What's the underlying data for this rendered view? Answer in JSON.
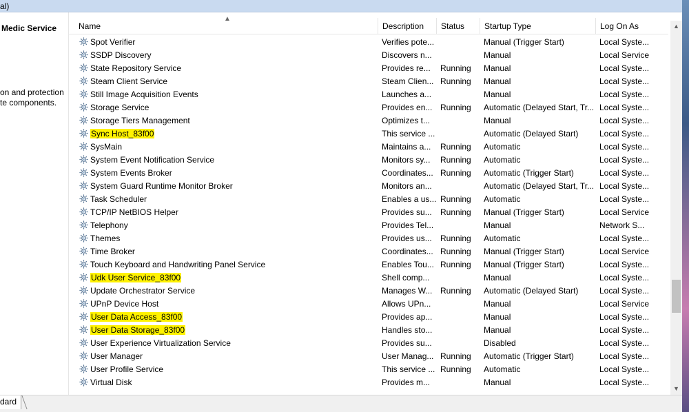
{
  "window": {
    "title_fragment": "al)"
  },
  "left_panel": {
    "service_name": "Medic Service",
    "description_lines": [
      "on and protection",
      "te components."
    ]
  },
  "columns": {
    "name": "Name",
    "description": "Description",
    "status": "Status",
    "startup_type": "Startup Type",
    "log_on_as": "Log On As"
  },
  "services": [
    {
      "name": "Spot Verifier",
      "description": "Verifies pote...",
      "status": "",
      "startup": "Manual (Trigger Start)",
      "logon": "Local Syste...",
      "highlighted": false
    },
    {
      "name": "SSDP Discovery",
      "description": "Discovers n...",
      "status": "",
      "startup": "Manual",
      "logon": "Local Service",
      "highlighted": false
    },
    {
      "name": "State Repository Service",
      "description": "Provides re...",
      "status": "Running",
      "startup": "Manual",
      "logon": "Local Syste...",
      "highlighted": false
    },
    {
      "name": "Steam Client Service",
      "description": "Steam Clien...",
      "status": "Running",
      "startup": "Manual",
      "logon": "Local Syste...",
      "highlighted": false
    },
    {
      "name": "Still Image Acquisition Events",
      "description": "Launches a...",
      "status": "",
      "startup": "Manual",
      "logon": "Local Syste...",
      "highlighted": false
    },
    {
      "name": "Storage Service",
      "description": "Provides en...",
      "status": "Running",
      "startup": "Automatic (Delayed Start, Tr...",
      "logon": "Local Syste...",
      "highlighted": false
    },
    {
      "name": "Storage Tiers Management",
      "description": "Optimizes t...",
      "status": "",
      "startup": "Manual",
      "logon": "Local Syste...",
      "highlighted": false
    },
    {
      "name": "Sync Host_83f00",
      "description": "This service ...",
      "status": "",
      "startup": "Automatic (Delayed Start)",
      "logon": "Local Syste...",
      "highlighted": true
    },
    {
      "name": "SysMain",
      "description": "Maintains a...",
      "status": "Running",
      "startup": "Automatic",
      "logon": "Local Syste...",
      "highlighted": false
    },
    {
      "name": "System Event Notification Service",
      "description": "Monitors sy...",
      "status": "Running",
      "startup": "Automatic",
      "logon": "Local Syste...",
      "highlighted": false
    },
    {
      "name": "System Events Broker",
      "description": "Coordinates...",
      "status": "Running",
      "startup": "Automatic (Trigger Start)",
      "logon": "Local Syste...",
      "highlighted": false
    },
    {
      "name": "System Guard Runtime Monitor Broker",
      "description": "Monitors an...",
      "status": "",
      "startup": "Automatic (Delayed Start, Tr...",
      "logon": "Local Syste...",
      "highlighted": false
    },
    {
      "name": "Task Scheduler",
      "description": "Enables a us...",
      "status": "Running",
      "startup": "Automatic",
      "logon": "Local Syste...",
      "highlighted": false
    },
    {
      "name": "TCP/IP NetBIOS Helper",
      "description": "Provides su...",
      "status": "Running",
      "startup": "Manual (Trigger Start)",
      "logon": "Local Service",
      "highlighted": false
    },
    {
      "name": "Telephony",
      "description": "Provides Tel...",
      "status": "",
      "startup": "Manual",
      "logon": "Network S...",
      "highlighted": false
    },
    {
      "name": "Themes",
      "description": "Provides us...",
      "status": "Running",
      "startup": "Automatic",
      "logon": "Local Syste...",
      "highlighted": false
    },
    {
      "name": "Time Broker",
      "description": "Coordinates...",
      "status": "Running",
      "startup": "Manual (Trigger Start)",
      "logon": "Local Service",
      "highlighted": false
    },
    {
      "name": "Touch Keyboard and Handwriting Panel Service",
      "description": "Enables Tou...",
      "status": "Running",
      "startup": "Manual (Trigger Start)",
      "logon": "Local Syste...",
      "highlighted": false
    },
    {
      "name": "Udk User Service_83f00",
      "description": "Shell comp...",
      "status": "",
      "startup": "Manual",
      "logon": "Local Syste...",
      "highlighted": true
    },
    {
      "name": "Update Orchestrator Service",
      "description": "Manages W...",
      "status": "Running",
      "startup": "Automatic (Delayed Start)",
      "logon": "Local Syste...",
      "highlighted": false
    },
    {
      "name": "UPnP Device Host",
      "description": "Allows UPn...",
      "status": "",
      "startup": "Manual",
      "logon": "Local Service",
      "highlighted": false
    },
    {
      "name": "User Data Access_83f00",
      "description": "Provides ap...",
      "status": "",
      "startup": "Manual",
      "logon": "Local Syste...",
      "highlighted": true
    },
    {
      "name": "User Data Storage_83f00",
      "description": "Handles sto...",
      "status": "",
      "startup": "Manual",
      "logon": "Local Syste...",
      "highlighted": true
    },
    {
      "name": "User Experience Virtualization Service",
      "description": "Provides su...",
      "status": "",
      "startup": "Disabled",
      "logon": "Local Syste...",
      "highlighted": false
    },
    {
      "name": "User Manager",
      "description": "User Manag...",
      "status": "Running",
      "startup": "Automatic (Trigger Start)",
      "logon": "Local Syste...",
      "highlighted": false
    },
    {
      "name": "User Profile Service",
      "description": "This service ...",
      "status": "Running",
      "startup": "Automatic",
      "logon": "Local Syste...",
      "highlighted": false
    },
    {
      "name": "Virtual Disk",
      "description": "Provides m...",
      "status": "",
      "startup": "Manual",
      "logon": "Local Syste...",
      "highlighted": false
    }
  ],
  "bottom_tab": {
    "label": "dard"
  },
  "colors": {
    "highlight": "#fff200",
    "header_border": "#e5e5e5",
    "scrollbar": "#f0f0f0"
  },
  "icons": {
    "service": "gear-icon",
    "sort": "sort-ascending-icon",
    "scroll_up": "scroll-up-arrow-icon",
    "scroll_down": "scroll-down-arrow-icon"
  }
}
